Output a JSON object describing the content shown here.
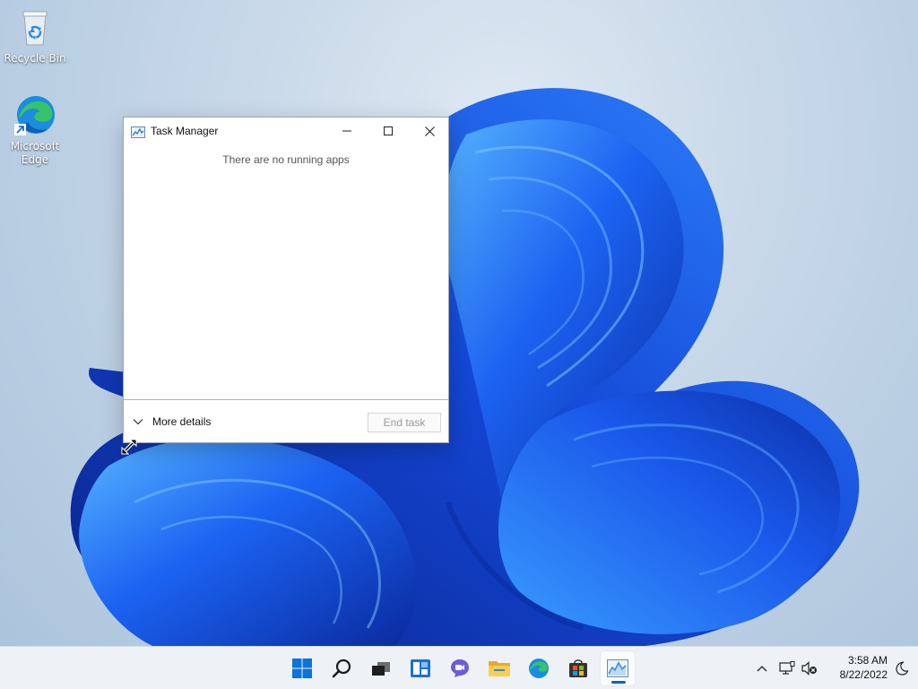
{
  "desktop": {
    "icons": [
      {
        "label": "Recycle Bin",
        "icon": "recycle-bin-icon"
      },
      {
        "label": "Microsoft Edge",
        "icon": "edge-icon"
      }
    ]
  },
  "window": {
    "title": "Task Manager",
    "app_icon": "task-manager-icon",
    "empty_message": "There are no running apps",
    "more_details_label": "More details",
    "end_task_label": "End task",
    "end_task_enabled": false,
    "caption_buttons": [
      "minimize",
      "maximize",
      "close"
    ]
  },
  "taskbar": {
    "apps": [
      {
        "name": "Start",
        "icon": "windows-start-icon"
      },
      {
        "name": "Search",
        "icon": "search-icon"
      },
      {
        "name": "Task View",
        "icon": "task-view-icon"
      },
      {
        "name": "Widgets",
        "icon": "widgets-icon"
      },
      {
        "name": "Chat",
        "icon": "chat-icon"
      },
      {
        "name": "File Explorer",
        "icon": "folder-icon"
      },
      {
        "name": "Microsoft Edge",
        "icon": "edge-icon"
      },
      {
        "name": "Microsoft Store",
        "icon": "store-icon"
      },
      {
        "name": "Task Manager",
        "icon": "task-manager-icon",
        "active": true
      }
    ],
    "tray": [
      "chevron-up-icon",
      "network-icon",
      "volume-muted-icon"
    ],
    "clock": {
      "time": "3:58 AM",
      "date": "8/22/2022"
    },
    "focus_icon": "moon-icon"
  },
  "colors": {
    "accent": "#0067c0",
    "bloom_dark": "#0b2fa8",
    "bloom_mid": "#1e5ff0",
    "bloom_light": "#3fa0ff"
  }
}
